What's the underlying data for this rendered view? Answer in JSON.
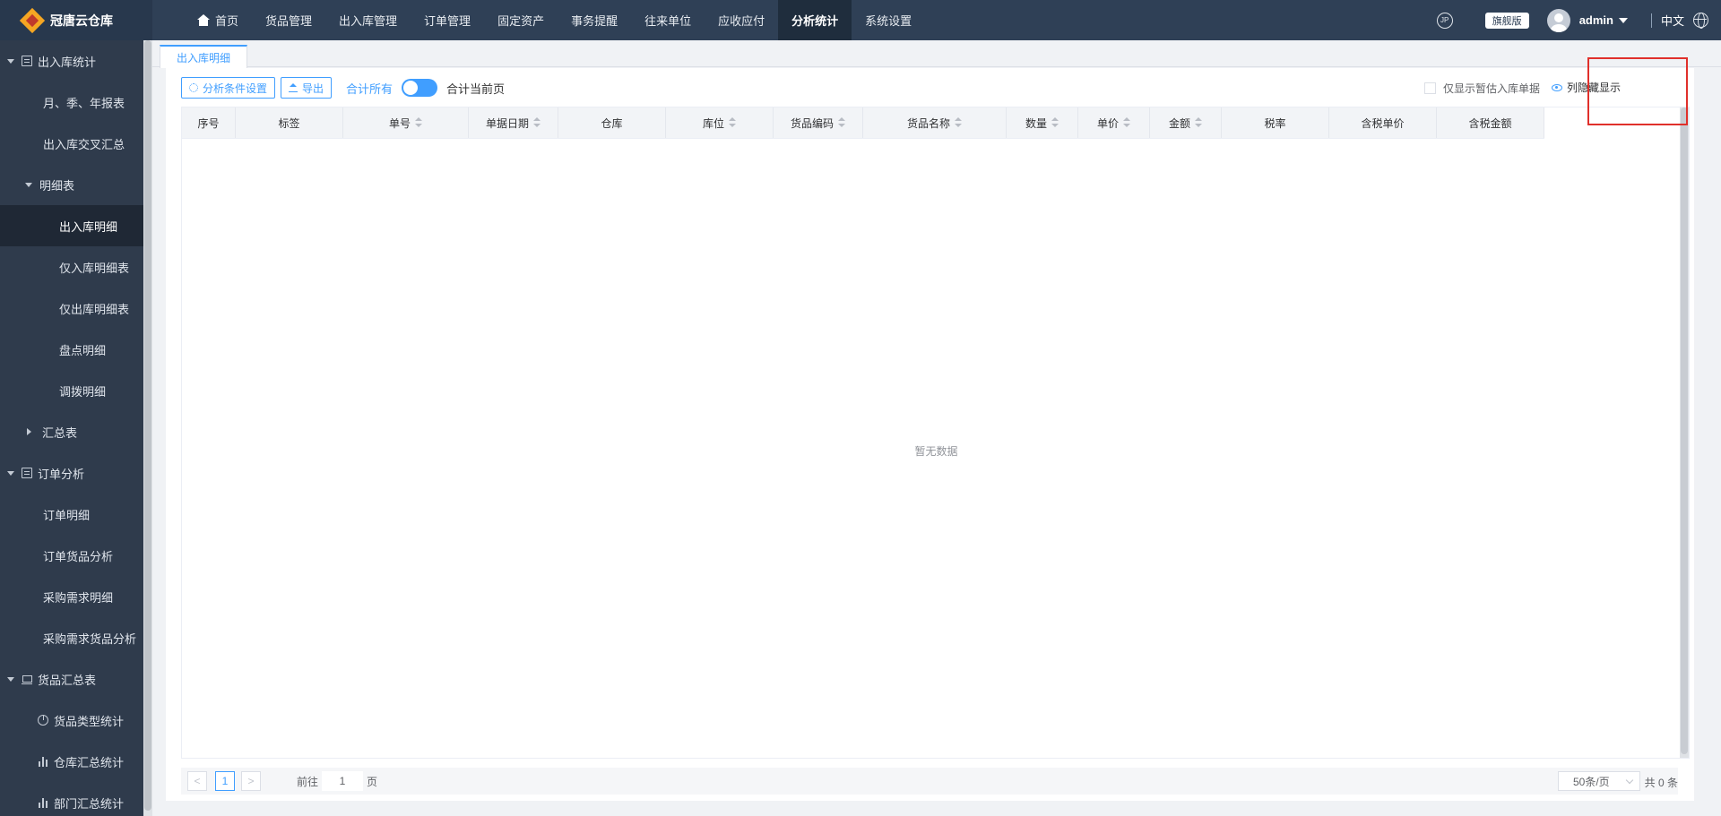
{
  "app": {
    "name": "冠唐云仓库"
  },
  "nav": {
    "items": [
      {
        "label": "首页"
      },
      {
        "label": "货品管理"
      },
      {
        "label": "出入库管理"
      },
      {
        "label": "订单管理"
      },
      {
        "label": "固定资产"
      },
      {
        "label": "事务提醒"
      },
      {
        "label": "往来单位"
      },
      {
        "label": "应收应付"
      },
      {
        "label": "分析统计"
      },
      {
        "label": "系统设置"
      }
    ],
    "active": "分析统计"
  },
  "header": {
    "icon_text": "JP",
    "edition": "旗舰版",
    "user": "admin",
    "language": "中文"
  },
  "sidebar": {
    "items": [
      {
        "label": "出入库统计"
      },
      {
        "label": "月、季、年报表"
      },
      {
        "label": "出入库交叉汇总"
      },
      {
        "label": "明细表"
      },
      {
        "label": "出入库明细"
      },
      {
        "label": "仅入库明细表"
      },
      {
        "label": "仅出库明细表"
      },
      {
        "label": "盘点明细"
      },
      {
        "label": "调拨明细"
      },
      {
        "label": "汇总表"
      },
      {
        "label": "订单分析"
      },
      {
        "label": "订单明细"
      },
      {
        "label": "订单货品分析"
      },
      {
        "label": "采购需求明细"
      },
      {
        "label": "采购需求货品分析"
      },
      {
        "label": "货品汇总表"
      },
      {
        "label": "货品类型统计"
      },
      {
        "label": "仓库汇总统计"
      },
      {
        "label": "部门汇总统计"
      }
    ],
    "active": "出入库明细"
  },
  "tab": {
    "label": "出入库明细"
  },
  "toolbar": {
    "analysis_settings": "分析条件设置",
    "export": "导出",
    "sum_all": "合计所有",
    "sum_current": "合计当前页",
    "show_estimated_only": "仅显示暂估入库单据",
    "column_visibility": "列隐藏显示"
  },
  "table": {
    "columns": [
      {
        "label": "序号"
      },
      {
        "label": "标签"
      },
      {
        "label": "单号"
      },
      {
        "label": "单据日期"
      },
      {
        "label": "仓库"
      },
      {
        "label": "库位"
      },
      {
        "label": "货品编码"
      },
      {
        "label": "货品名称"
      },
      {
        "label": "数量"
      },
      {
        "label": "单价"
      },
      {
        "label": "金额"
      },
      {
        "label": "税率"
      },
      {
        "label": "含税单价"
      },
      {
        "label": "含税金额"
      }
    ],
    "empty_text": "暂无数据"
  },
  "pagination": {
    "prev": "<",
    "current_page": "1",
    "next": ">",
    "goto_label": "前往",
    "goto_value": "1",
    "goto_unit": "页",
    "page_size": "50条/页",
    "total": "共 0 条"
  },
  "colors": {
    "accent": "#409eff",
    "topbar": "#2f4056",
    "sidebar": "#2f3b4c",
    "highlight": "#e0302b"
  }
}
